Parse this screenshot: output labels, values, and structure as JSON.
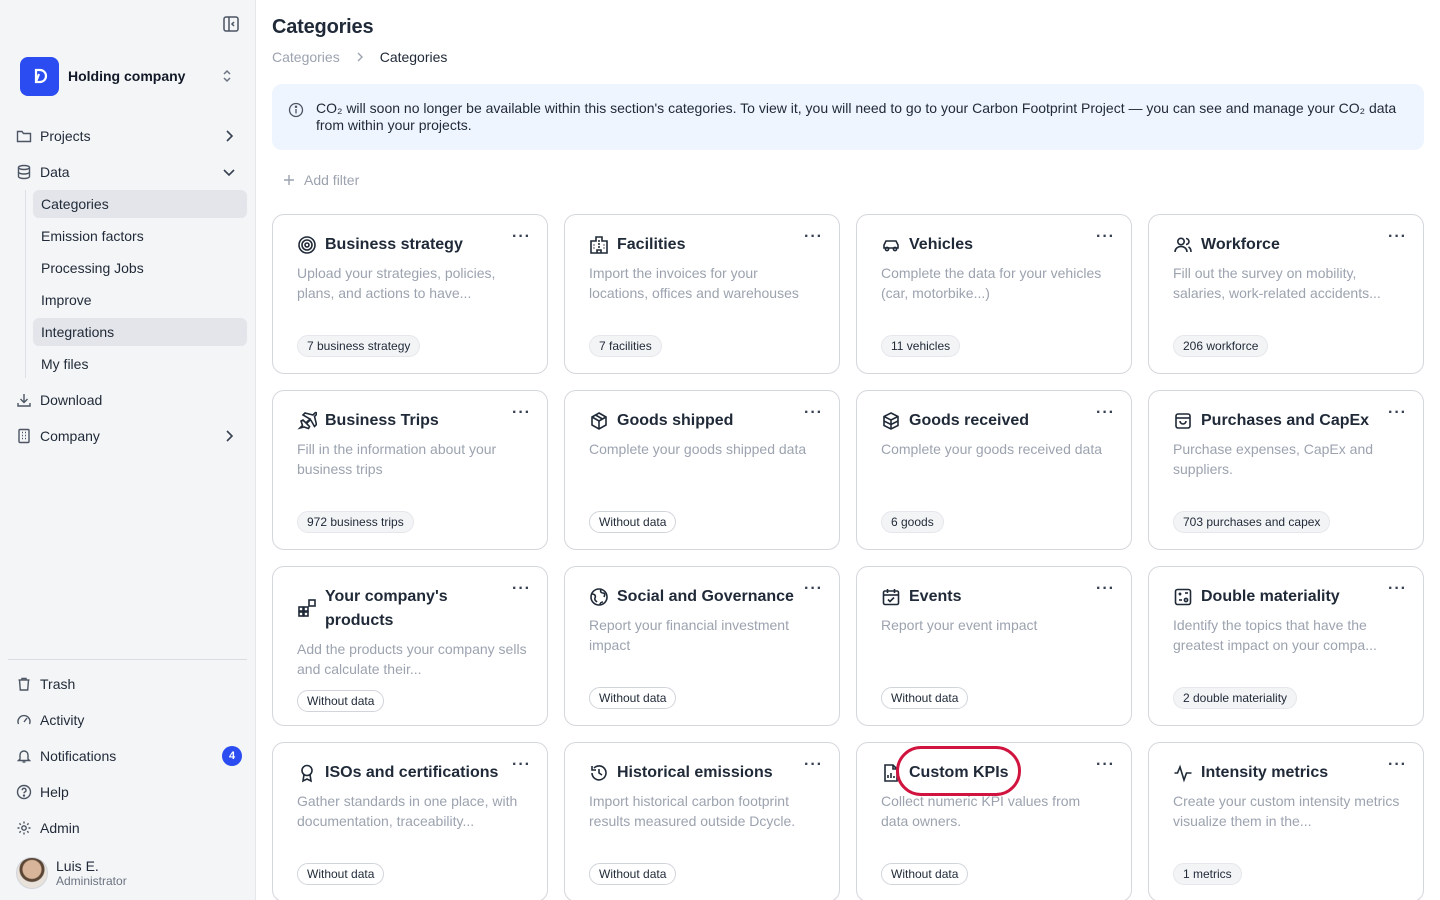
{
  "sidebar": {
    "org_name": "Holding company",
    "nav": {
      "projects": "Projects",
      "data": "Data",
      "download": "Download",
      "company": "Company"
    },
    "data_sub": {
      "categories": "Categories",
      "emission_factors": "Emission factors",
      "processing_jobs": "Processing Jobs",
      "improve": "Improve",
      "integrations": "Integrations",
      "my_files": "My files"
    },
    "bottom": {
      "trash": "Trash",
      "activity": "Activity",
      "notifications": "Notifications",
      "notifications_count": "4",
      "help": "Help",
      "admin": "Admin"
    },
    "user": {
      "name": "Luis E.",
      "role": "Administrator"
    }
  },
  "header": {
    "title": "Categories",
    "breadcrumb": [
      "Categories",
      "Categories"
    ]
  },
  "banner": {
    "text": "CO₂ will soon no longer be available within this section's categories. To view it, you will need to go to your Carbon Footprint Project — you can see and manage your CO₂ data from within your projects."
  },
  "filter": {
    "add_label": "Add filter"
  },
  "cards": [
    {
      "title": "Business strategy",
      "desc": "Upload your strategies, policies, plans, and actions to have...",
      "badge": "7 business strategy",
      "icon": "target-icon"
    },
    {
      "title": "Facilities",
      "desc": "Import the invoices for your locations, offices and warehouses",
      "badge": "7 facilities",
      "icon": "building-icon"
    },
    {
      "title": "Vehicles",
      "desc": "Complete the data for your vehicles (car, motorbike...)",
      "badge": "11 vehicles",
      "icon": "car-icon"
    },
    {
      "title": "Workforce",
      "desc": "Fill out the survey on mobility, salaries, work-related accidents...",
      "badge": "206 workforce",
      "icon": "users-icon"
    },
    {
      "title": "Business Trips",
      "desc": "Fill in the information about your business trips",
      "badge": "972 business trips",
      "icon": "plane-icon"
    },
    {
      "title": "Goods shipped",
      "desc": "Complete your goods shipped data",
      "badge": "Without data",
      "icon": "box-icon"
    },
    {
      "title": "Goods received",
      "desc": "Complete your goods received data",
      "badge": "6 goods",
      "icon": "boxes-icon"
    },
    {
      "title": "Purchases and CapEx",
      "desc": "Purchase expenses, CapEx and suppliers.",
      "badge": "703 purchases and capex",
      "icon": "shopping-bag-icon"
    },
    {
      "title": "Your company's products",
      "desc": "Add the products your company sells and calculate their...",
      "badge": "Without data",
      "icon": "shapes-icon"
    },
    {
      "title": "Social and Governance",
      "desc": "Report your financial investment impact",
      "badge": "Without data",
      "icon": "globe-icon"
    },
    {
      "title": "Events",
      "desc": "Report your event impact",
      "badge": "Without data",
      "icon": "calendar-icon"
    },
    {
      "title": "Double materiality",
      "desc": "Identify the topics that have the greatest impact on your compa...",
      "badge": "2 double materiality",
      "icon": "matrix-icon"
    },
    {
      "title": "ISOs and certifications",
      "desc": "Gather standards in one place, with documentation, traceability...",
      "badge": "Without data",
      "icon": "award-icon"
    },
    {
      "title": "Historical emissions",
      "desc": "Import historical carbon footprint results measured outside Dcycle.",
      "badge": "Without data",
      "icon": "history-icon"
    },
    {
      "title": "Custom KPIs",
      "desc": "Collect numeric KPI values from data owners.",
      "badge": "Without data",
      "icon": "chart-file-icon"
    },
    {
      "title": "Intensity metrics",
      "desc": "Create your custom intensity metrics visualize them in the...",
      "badge": "1 metrics",
      "icon": "activity-icon"
    }
  ],
  "more_label": "···"
}
